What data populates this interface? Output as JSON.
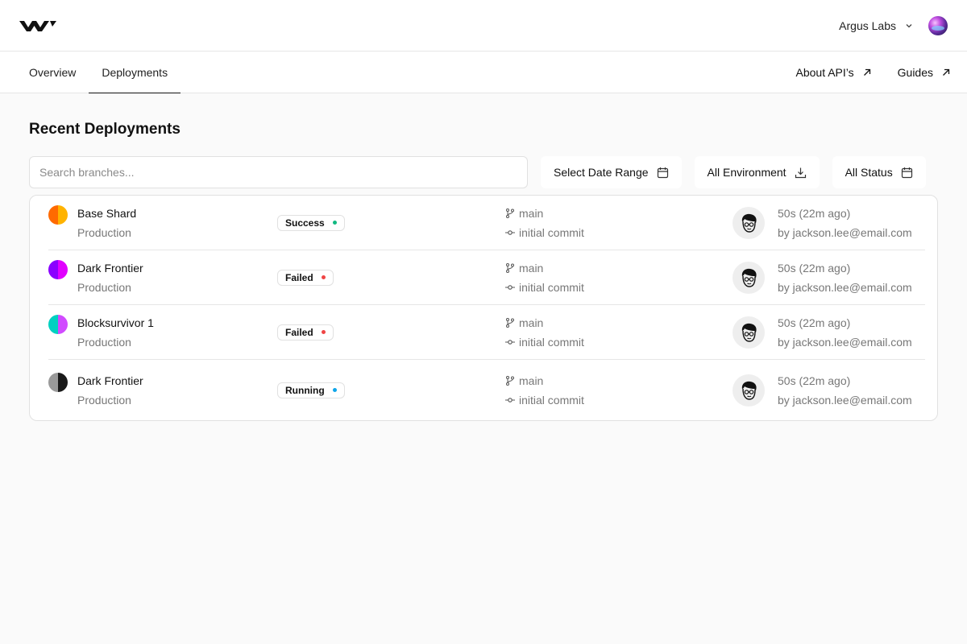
{
  "header": {
    "workspace": "Argus Labs",
    "icons": {
      "logo": "w-logo-icon",
      "dropdown": "chevron-down-icon",
      "avatar": "user-avatar"
    }
  },
  "nav": {
    "tabs": [
      {
        "label": "Overview",
        "active": false
      },
      {
        "label": "Deployments",
        "active": true
      }
    ],
    "links": [
      {
        "label": "About API’s",
        "icon": "arrow-up-right-icon"
      },
      {
        "label": "Guides",
        "icon": "arrow-up-right-icon"
      }
    ]
  },
  "main": {
    "title": "Recent Deployments",
    "search": {
      "placeholder": "Search branches...",
      "value": ""
    },
    "filters": [
      {
        "label": "Select Date Range",
        "icon": "calendar-icon"
      },
      {
        "label": "All Environment",
        "icon": "download-icon"
      },
      {
        "label": "All Status",
        "icon": "calendar-icon"
      }
    ],
    "deployments": [
      {
        "name": "Base Shard",
        "environment": "Production",
        "status": "Success",
        "status_color": "#10b981",
        "branch": "main",
        "commit": "initial commit",
        "time": "50s (22m ago)",
        "author": "by jackson.lee@email.com"
      },
      {
        "name": "Dark Frontier",
        "environment": "Production",
        "status": "Failed",
        "status_color": "#ef4444",
        "branch": "main",
        "commit": "initial commit",
        "time": "50s (22m ago)",
        "author": "by jackson.lee@email.com"
      },
      {
        "name": "Blocksurvivor 1",
        "environment": "Production",
        "status": "Failed",
        "status_color": "#ef4444",
        "branch": "main",
        "commit": "initial commit",
        "time": "50s (22m ago)",
        "author": "by jackson.lee@email.com"
      },
      {
        "name": "Dark Frontier",
        "environment": "Production",
        "status": "Running",
        "status_color": "#0ea5e9",
        "branch": "main",
        "commit": "initial commit",
        "time": "50s (22m ago)",
        "author": "by jackson.lee@email.com"
      }
    ]
  }
}
